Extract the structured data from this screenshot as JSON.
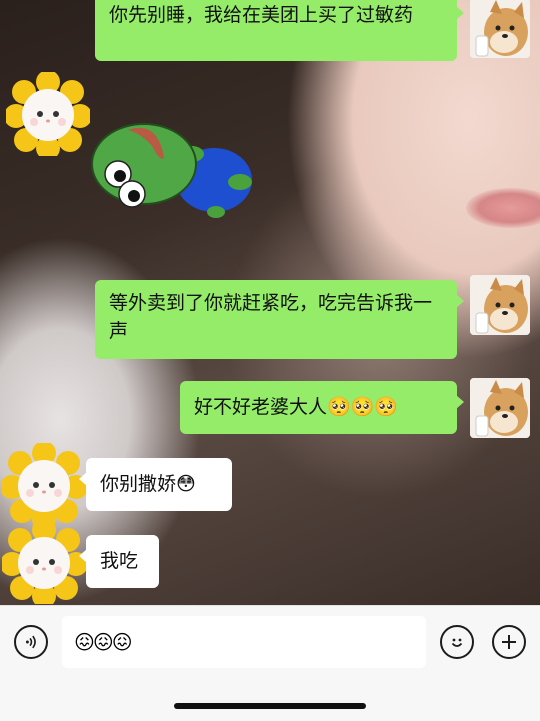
{
  "messages": [
    {
      "sender": "me",
      "text": "你先别睡，我给在美团上买了过敏药"
    },
    {
      "sender": "them",
      "sticker": "pepe-frog-lying-sticker"
    },
    {
      "sender": "me",
      "text": "等外卖到了你就赶紧吃，吃完告诉我一声"
    },
    {
      "sender": "me",
      "text": "好不好老婆大人🥺🥺🥺"
    },
    {
      "sender": "them",
      "text": "你别撒娇😳"
    },
    {
      "sender": "them",
      "text": "我吃"
    }
  ],
  "avatars": {
    "me": "shiba-doge-avatar",
    "them": "cat-sunflower-avatar"
  },
  "input_bar": {
    "value": "😖😖😖",
    "voice_icon": "voice-icon",
    "emoji_icon": "emoji-icon",
    "add_icon": "plus-icon"
  },
  "colors": {
    "my_bubble": "#95ec69",
    "their_bubble": "#ffffff",
    "bar_bg": "#f7f7f7"
  }
}
